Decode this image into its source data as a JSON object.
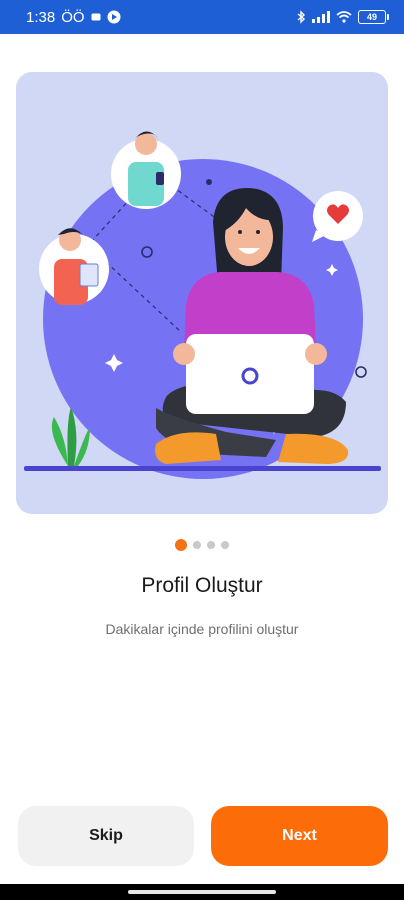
{
  "status_bar": {
    "time": "1:38",
    "extra": "ÖÖ",
    "battery": "49"
  },
  "onboarding": {
    "title": "Profil Oluştur",
    "subtitle": "Dakikalar içinde profilini oluştur",
    "page_count": 4,
    "active_page": 1
  },
  "buttons": {
    "skip": "Skip",
    "next": "Next"
  },
  "colors": {
    "status_bar": "#1f5fd6",
    "accent": "#fc6d09",
    "card_bg": "#d0d8f6",
    "planet": "#7672f4"
  },
  "icons": [
    "image-notification-icon",
    "play-store-icon",
    "bluetooth-icon",
    "signal-icon",
    "wifi-icon",
    "battery-icon",
    "heart-icon"
  ]
}
